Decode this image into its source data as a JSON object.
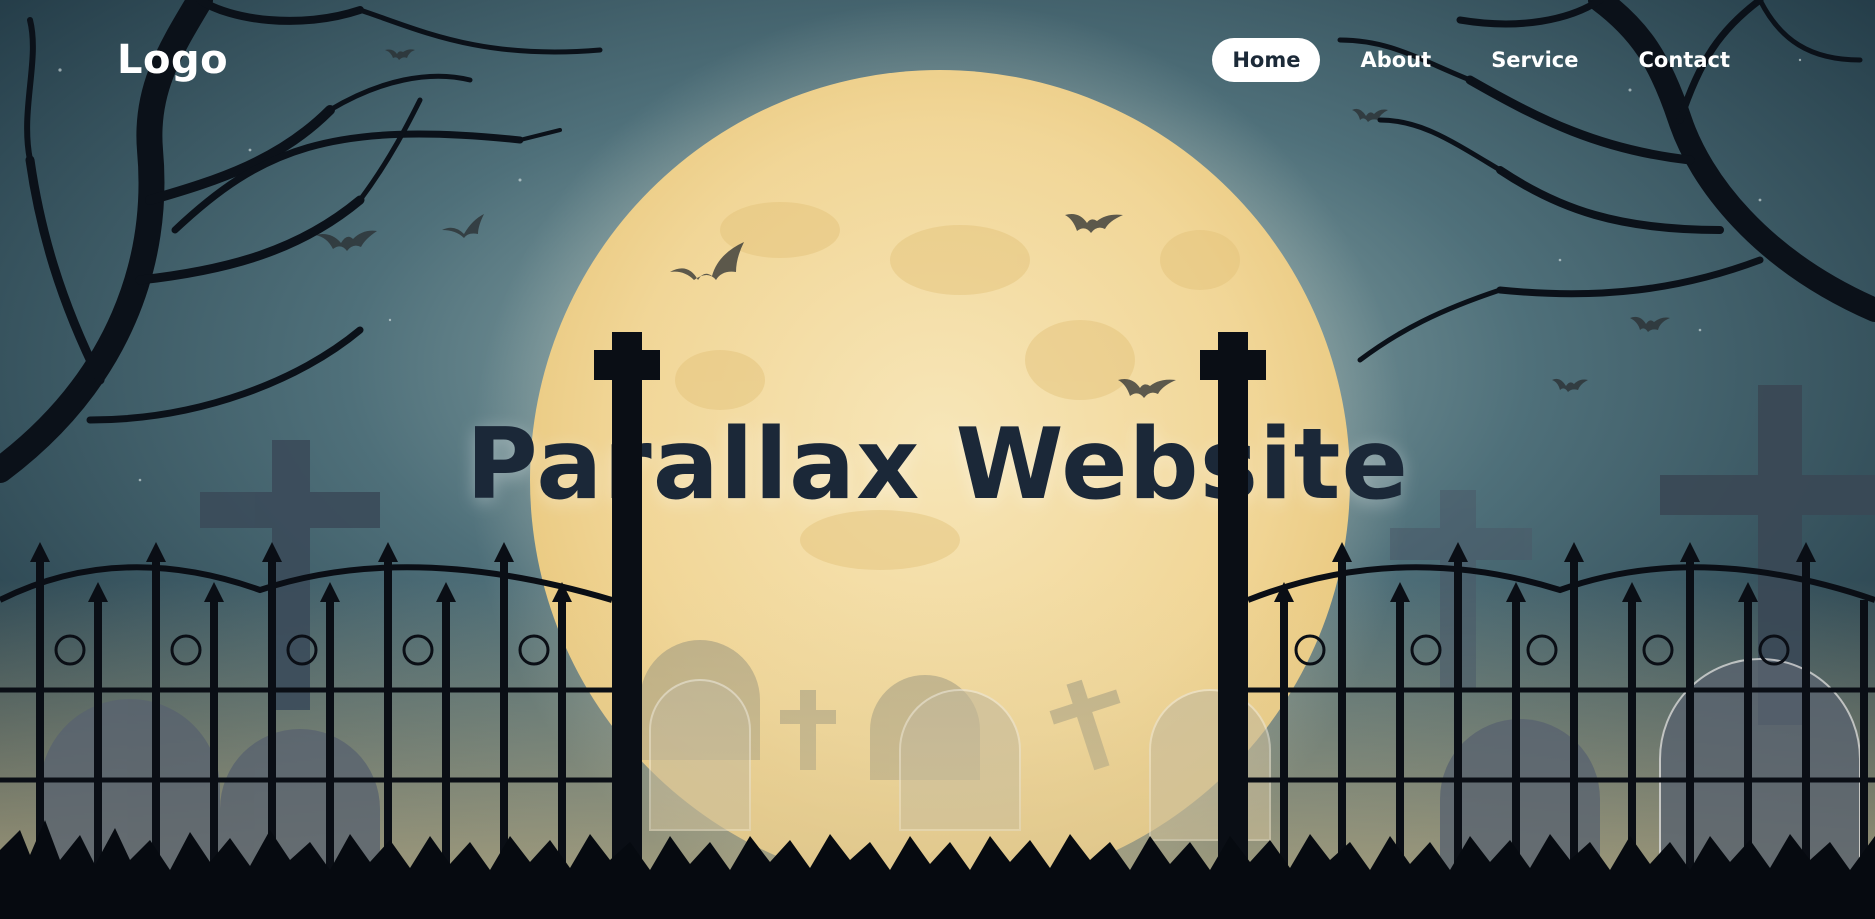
{
  "header": {
    "logo": "Logo",
    "nav": [
      {
        "label": "Home",
        "active": true
      },
      {
        "label": "About",
        "active": false
      },
      {
        "label": "Service",
        "active": false
      },
      {
        "label": "Contact",
        "active": false
      }
    ]
  },
  "hero": {
    "title": "Parallax Website"
  },
  "colors": {
    "sky": "#2c4a56",
    "moon": "#f5dfa3",
    "silhouette": "#0a0f17",
    "title": "#1b2838",
    "nav_active_bg": "#ffffff"
  }
}
